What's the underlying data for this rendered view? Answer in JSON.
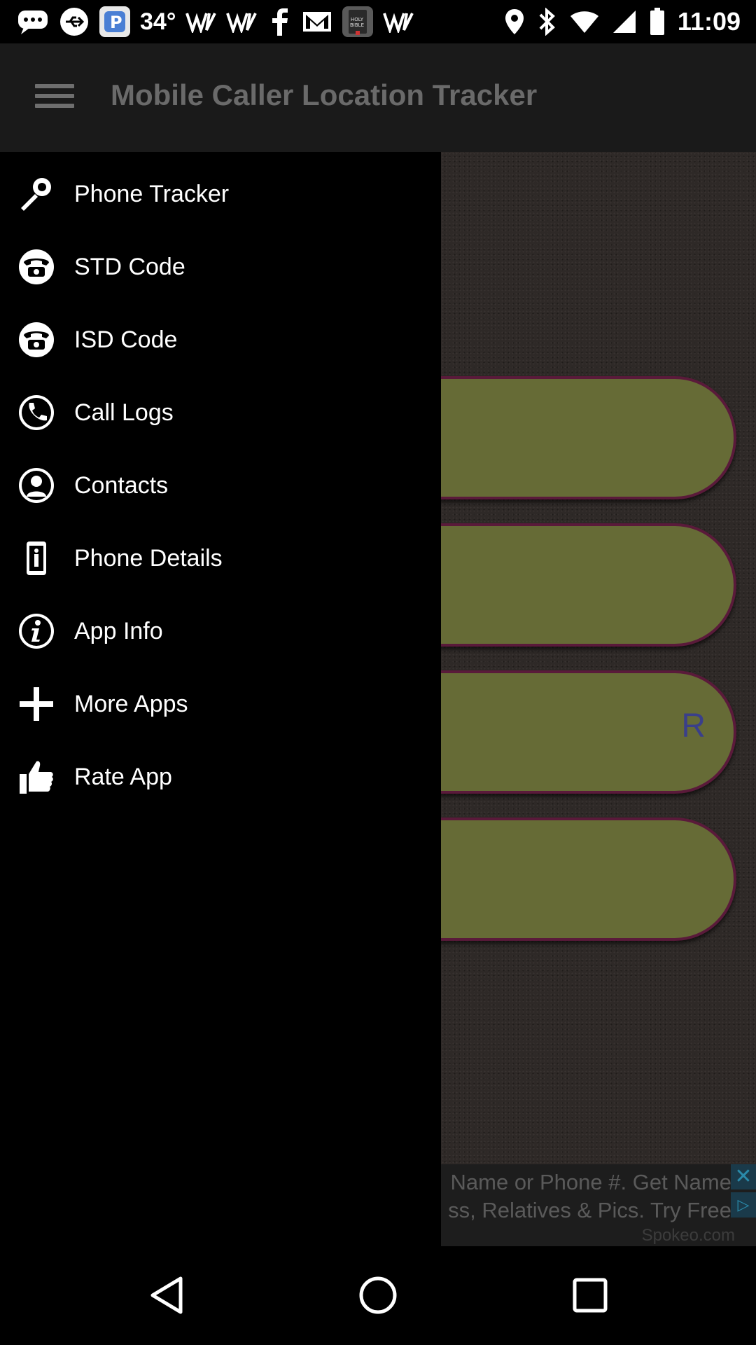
{
  "status_bar": {
    "temperature": "34°",
    "time": "11:09"
  },
  "app_bar": {
    "title": "Mobile Caller Location Tracker",
    "menu_icon": "hamburger-menu-icon"
  },
  "drawer": {
    "items": [
      {
        "label": "Phone Tracker",
        "icon": "search-key-icon"
      },
      {
        "label": "STD Code",
        "icon": "telephone-icon"
      },
      {
        "label": "ISD Code",
        "icon": "telephone-icon"
      },
      {
        "label": "Call Logs",
        "icon": "phone-handset-icon"
      },
      {
        "label": "Contacts",
        "icon": "person-icon"
      },
      {
        "label": "Phone Details",
        "icon": "phone-info-icon"
      },
      {
        "label": "App Info",
        "icon": "info-icon"
      },
      {
        "label": "More Apps",
        "icon": "plus-icon"
      },
      {
        "label": "Rate App",
        "icon": "thumbs-up-icon"
      }
    ]
  },
  "main": {
    "pill_partial_text": "R"
  },
  "ad": {
    "line1": "Name or Phone #. Get Name",
    "line2": "ss, Relatives & Pics. Try Free",
    "source": "Spokeo.com"
  },
  "colors": {
    "drawer_bg": "#000000",
    "app_bar_bg": "#1a1a1a",
    "pill_fill": "#666b36",
    "pill_border": "#5a1a3a"
  }
}
